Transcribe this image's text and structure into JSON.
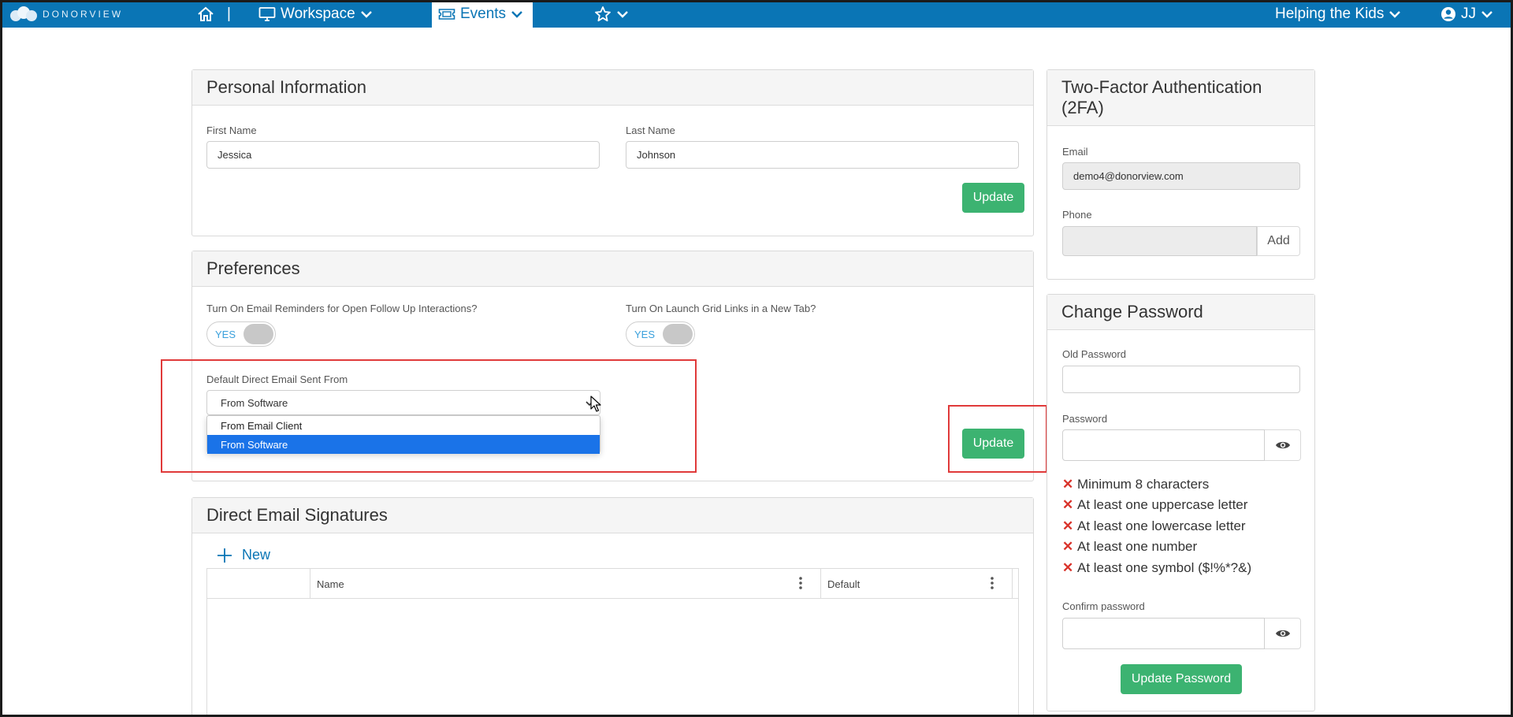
{
  "nav": {
    "brand": "DONORVIEW",
    "separator": "|",
    "workspace_label": "Workspace",
    "events_label": "Events",
    "org_label": "Helping the Kids",
    "user_initials": "JJ"
  },
  "personal_info": {
    "title": "Personal Information",
    "first_name_label": "First Name",
    "first_name_value": "Jessica",
    "last_name_label": "Last Name",
    "last_name_value": "Johnson",
    "update_label": "Update"
  },
  "preferences": {
    "title": "Preferences",
    "email_reminders_label": "Turn On Email Reminders for Open Follow Up Interactions?",
    "email_reminders_toggle": "YES",
    "grid_links_label": "Turn On Launch Grid Links in a New Tab?",
    "grid_links_toggle": "YES",
    "default_email_label": "Default Direct Email Sent From",
    "default_email_value": "From Software",
    "default_email_options": [
      "From Email Client",
      "From Software"
    ],
    "update_label": "Update"
  },
  "signatures": {
    "title": "Direct Email Signatures",
    "new_label": "New",
    "columns": [
      "Name",
      "Default"
    ]
  },
  "two_factor": {
    "title": "Two-Factor Authentication (2FA)",
    "email_label": "Email",
    "email_value": "demo4@donorview.com",
    "phone_label": "Phone",
    "phone_value": "",
    "add_label": "Add"
  },
  "change_password": {
    "title": "Change Password",
    "old_password_label": "Old Password",
    "password_label": "Password",
    "requirements": [
      "Minimum 8 characters",
      "At least one uppercase letter",
      "At least one lowercase letter",
      "At least one number",
      "At least one symbol ($!%*?&)"
    ],
    "confirm_label": "Confirm password",
    "update_label": "Update Password"
  },
  "colors": {
    "nav_blue": "#0a75b5",
    "button_green": "#3cb371",
    "highlight_red": "#e03a3a",
    "selected_option": "#1a73e8",
    "error_x": "#d9332b"
  }
}
